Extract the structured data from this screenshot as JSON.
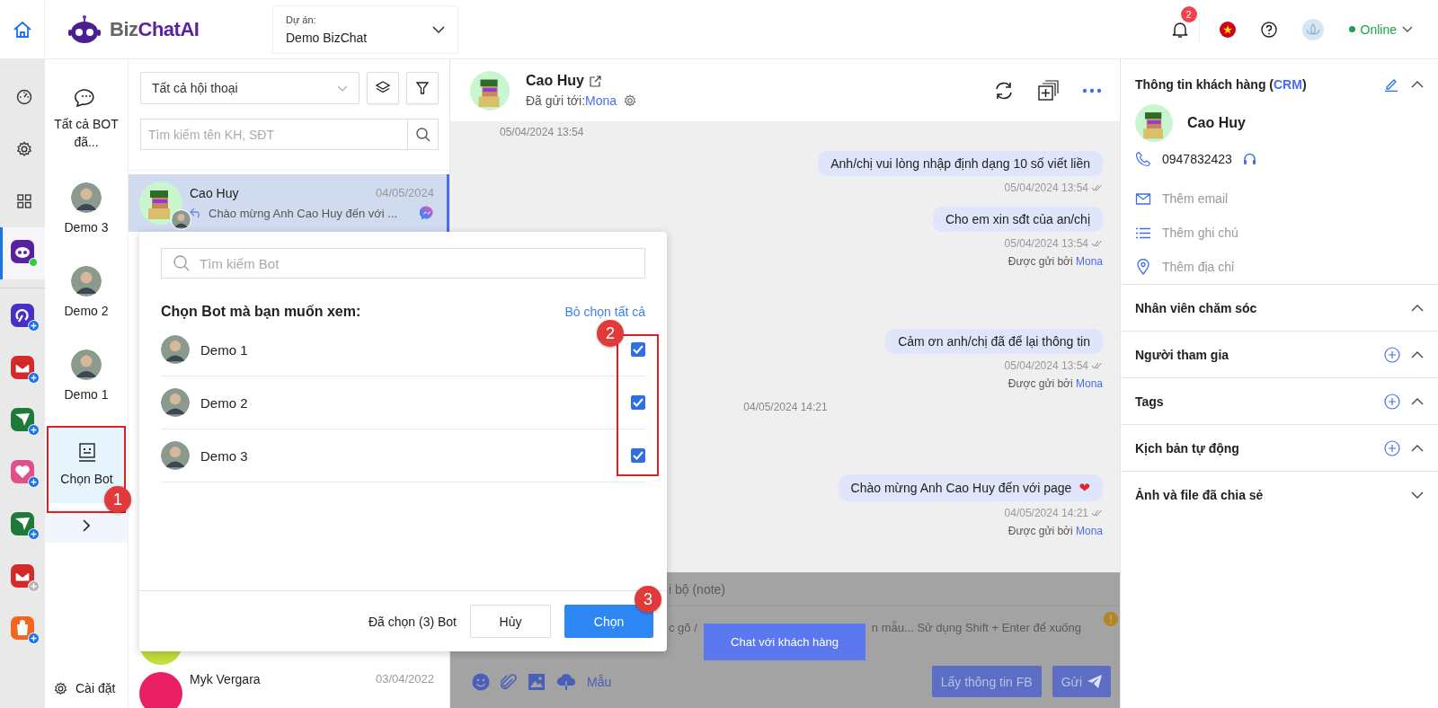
{
  "topbar": {
    "logo_prefix": "Biz",
    "logo_name": "ChatAI",
    "project": {
      "label": "Dự án:",
      "value": "Demo BizChat"
    },
    "notifications": "2",
    "status": "Online"
  },
  "rail": {
    "tools": [
      {
        "kind": "dashboard",
        "selected": false
      },
      {
        "kind": "settings",
        "selected": false
      },
      {
        "kind": "apps",
        "selected": false
      },
      {
        "kind": "bot",
        "selected": true
      }
    ],
    "channels": [
      {
        "kind": "swirl",
        "color": "#4a2fc7",
        "disabled": false
      },
      {
        "kind": "mail",
        "color": "#d42a2a",
        "disabled": false
      },
      {
        "kind": "plane",
        "color": "#1f7a3a",
        "disabled": false
      },
      {
        "kind": "heart",
        "color": "#e0508a",
        "disabled": false
      },
      {
        "kind": "plane",
        "color": "#1f7a3a",
        "disabled": false
      },
      {
        "kind": "mail",
        "color": "#d42a2a",
        "disabled": true
      },
      {
        "kind": "bag",
        "color": "#f2661f",
        "disabled": false
      }
    ]
  },
  "bot_column": {
    "items": [
      {
        "kind": "all",
        "label": "Tất cả BOT đã...",
        "selected": false
      },
      {
        "kind": "bot",
        "label": "Demo 3",
        "selected": false
      },
      {
        "kind": "bot",
        "label": "Demo 2",
        "selected": false
      },
      {
        "kind": "bot",
        "label": "Demo 1",
        "selected": false
      },
      {
        "kind": "choose",
        "label": "Chọn Bot",
        "selected": true
      }
    ],
    "settings": "Cài đặt"
  },
  "conversations": {
    "filter": "Tất cả hội thoại",
    "search_placeholder": "Tìm kiếm tên KH, SĐT",
    "rows": [
      {
        "name": "Cao Huy",
        "date": "04/05/2024",
        "preview": "Chào mừng Anh Cao Huy đến với ...",
        "color": "#c9f5cf",
        "selected": true
      },
      {
        "color": "#c3dd3a",
        "selected": false
      },
      {
        "name": "Myk Vergara",
        "date": "03/04/2022",
        "color": "#e91e63",
        "selected": false
      }
    ]
  },
  "chat": {
    "name": "Cao Huy",
    "sent_to_label": "Đã gửi tới:",
    "sent_to": "Mona",
    "messages": [
      {
        "kind": "stamp",
        "text": "05/04/2024 13:54"
      },
      {
        "kind": "out",
        "text": "Anh/chị vui lòng nhập định dạng 10 số viết liền",
        "time": "05/04/2024 13:54"
      },
      {
        "kind": "out",
        "text": "Cho em xin sđt của an/chị",
        "time": "05/04/2024 13:54",
        "sender_label": "Được gửi bởi",
        "sender": "Mona"
      },
      {
        "kind": "out",
        "text": "Cảm ơn anh/chị đã để lại thông tin",
        "time": "05/04/2024 13:54",
        "sender_label": "Được gửi bởi",
        "sender": "Mona"
      },
      {
        "kind": "divider",
        "text": "04/05/2024 14:21"
      },
      {
        "kind": "out",
        "text": "Chào mừng Anh Cao Huy đến với page",
        "emoji": "❤",
        "time": "04/05/2024 14:21",
        "sender_label": "Được gửi bởi",
        "sender": "Mona"
      }
    ],
    "compose": {
      "tab": "i bộ (note)",
      "placeholder_start": "c gõ /",
      "placeholder_end": "n mẫu... Sử dụng Shift + Enter để xuống",
      "templates": "Mẫu",
      "fetch_button": "Lấy thông tin FB",
      "send_button": "Gửi"
    },
    "tooltip": "Chat với khách hàng"
  },
  "customer": {
    "title_prefix": "Thông tin khách hàng (",
    "title_link": "CRM",
    "title_suffix": ")",
    "name": "Cao Huy",
    "phone": "0947832423",
    "fields": [
      {
        "kind": "email",
        "label": "Thêm email"
      },
      {
        "kind": "note",
        "label": "Thêm ghi chú"
      },
      {
        "kind": "address",
        "label": "Thêm địa chỉ"
      }
    ],
    "sections": [
      {
        "title": "Nhân viên chăm sóc",
        "expanded": true,
        "addable": false
      },
      {
        "title": "Người tham gia",
        "expanded": true,
        "addable": true
      },
      {
        "title": "Tags",
        "expanded": true,
        "addable": true
      },
      {
        "title": "Kịch bản tự động",
        "expanded": true,
        "addable": true
      },
      {
        "title": "Ảnh và file đã chia sẻ",
        "expanded": false,
        "addable": false
      }
    ]
  },
  "bot_dialog": {
    "search_placeholder": "Tìm kiếm Bot",
    "title": "Chọn Bot mà bạn muốn xem:",
    "clear_all": "Bỏ chọn tất cả",
    "bots": [
      {
        "name": "Demo 1",
        "checked": true
      },
      {
        "name": "Demo 2",
        "checked": true
      },
      {
        "name": "Demo 3",
        "checked": true
      }
    ],
    "summary": "Đã chọn (3) Bot",
    "cancel": "Hủy",
    "confirm": "Chọn"
  },
  "annotations": [
    "1",
    "2",
    "3"
  ]
}
